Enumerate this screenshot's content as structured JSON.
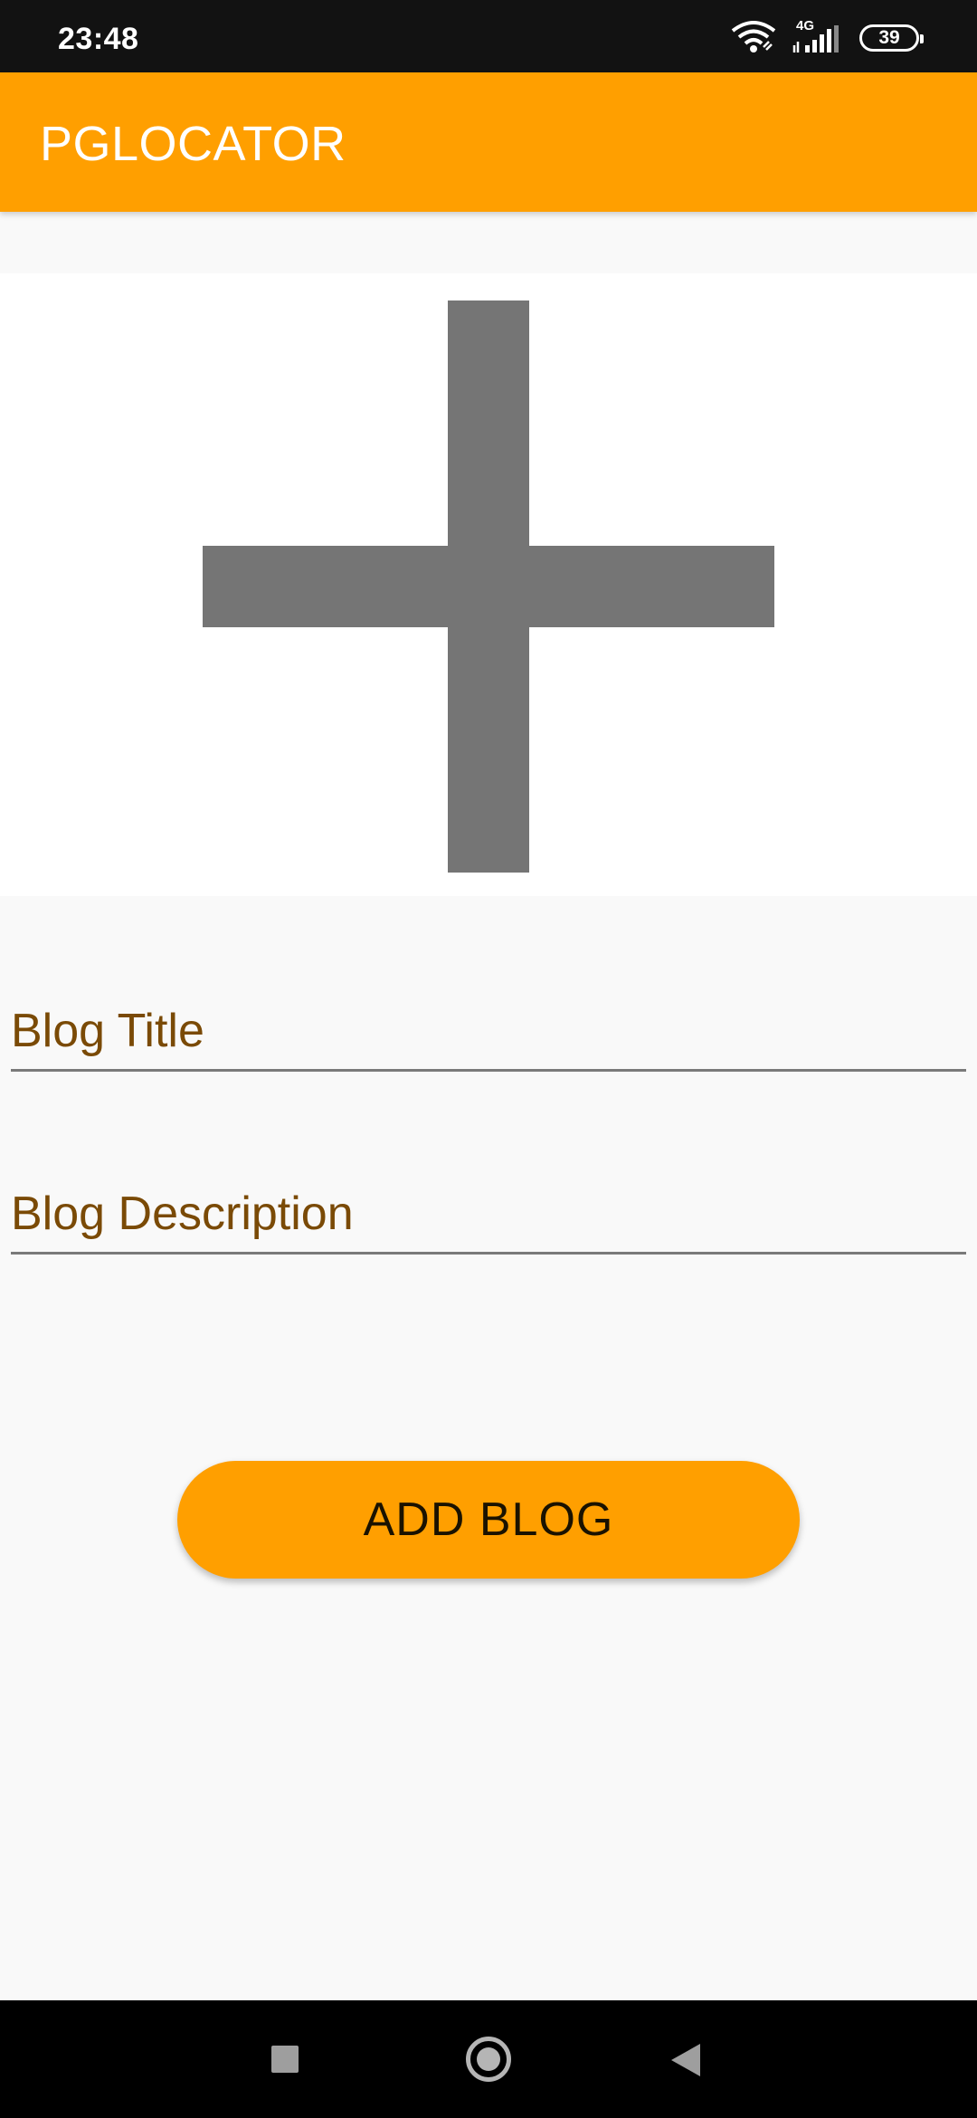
{
  "status_bar": {
    "time": "23:48",
    "network_label": "4G",
    "battery_level": "39",
    "icons": [
      "wifi-icon",
      "signal-icon",
      "battery-icon"
    ]
  },
  "app_bar": {
    "title": "PGLOCATOR",
    "color": "#ff9f00"
  },
  "image_picker": {
    "icon": "plus-icon"
  },
  "form": {
    "title_placeholder": "Blog Title",
    "title_value": "",
    "description_placeholder": "Blog Description",
    "description_value": ""
  },
  "actions": {
    "add_label": "ADD BLOG"
  },
  "nav_bar": {
    "icons": [
      "recents-icon",
      "home-icon",
      "back-icon"
    ]
  }
}
